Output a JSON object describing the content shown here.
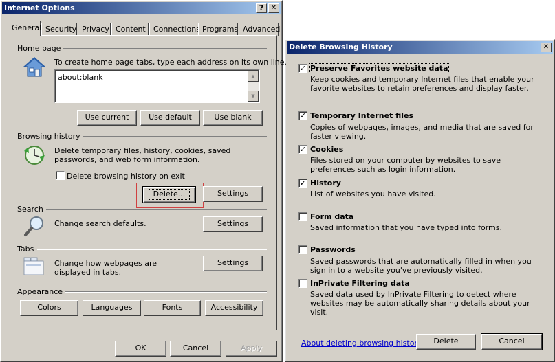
{
  "internet_options": {
    "title": "Internet Options",
    "help_button": "?",
    "close_button": "✕",
    "tabs": [
      "General",
      "Security",
      "Privacy",
      "Content",
      "Connections",
      "Programs",
      "Advanced"
    ],
    "home_page": {
      "group_label": "Home page",
      "description": "To create home page tabs, type each address on its own line.",
      "value": "about:blank",
      "use_current": "Use current",
      "use_default": "Use default",
      "use_blank": "Use blank"
    },
    "browsing_history": {
      "group_label": "Browsing history",
      "description": "Delete temporary files, history, cookies, saved passwords, and web form information.",
      "delete_on_exit_label": "Delete browsing history on exit",
      "delete_on_exit_checked": false,
      "delete_button": "Delete...",
      "settings_button": "Settings"
    },
    "search": {
      "group_label": "Search",
      "description": "Change search defaults.",
      "settings_button": "Settings"
    },
    "tabs_section": {
      "group_label": "Tabs",
      "description": "Change how webpages are displayed in tabs.",
      "settings_button": "Settings"
    },
    "appearance": {
      "group_label": "Appearance",
      "colors": "Colors",
      "languages": "Languages",
      "fonts": "Fonts",
      "accessibility": "Accessibility"
    },
    "footer": {
      "ok": "OK",
      "cancel": "Cancel",
      "apply": "Apply"
    }
  },
  "delete_browsing_history": {
    "title": "Delete Browsing History",
    "close_button": "✕",
    "options": [
      {
        "label": "Preserve Favorites website data",
        "description": "Keep cookies and temporary Internet files that enable your favorite websites to retain preferences and display faster.",
        "checked": true
      },
      {
        "label": "Temporary Internet files",
        "description": "Copies of webpages, images, and media that are saved for faster viewing.",
        "checked": true
      },
      {
        "label": "Cookies",
        "description": "Files stored on your computer by websites to save preferences such as login information.",
        "checked": true
      },
      {
        "label": "History",
        "description": "List of websites you have visited.",
        "checked": true
      },
      {
        "label": "Form data",
        "description": "Saved information that you have typed into forms.",
        "checked": false
      },
      {
        "label": "Passwords",
        "description": "Saved passwords that are automatically filled in when you sign in to a website you've previously visited.",
        "checked": false
      },
      {
        "label": "InPrivate Filtering data",
        "description": "Saved data used by InPrivate Filtering to detect where websites may be automatically sharing details about your visit.",
        "checked": false
      }
    ],
    "about_link": "About deleting browsing history",
    "delete_button": "Delete",
    "cancel_button": "Cancel"
  },
  "colors": {
    "title_start": "#0a246a",
    "title_end": "#a6caf0",
    "face": "#d4d0c8",
    "highlight_box": "#d04040",
    "link": "#0000cc"
  }
}
